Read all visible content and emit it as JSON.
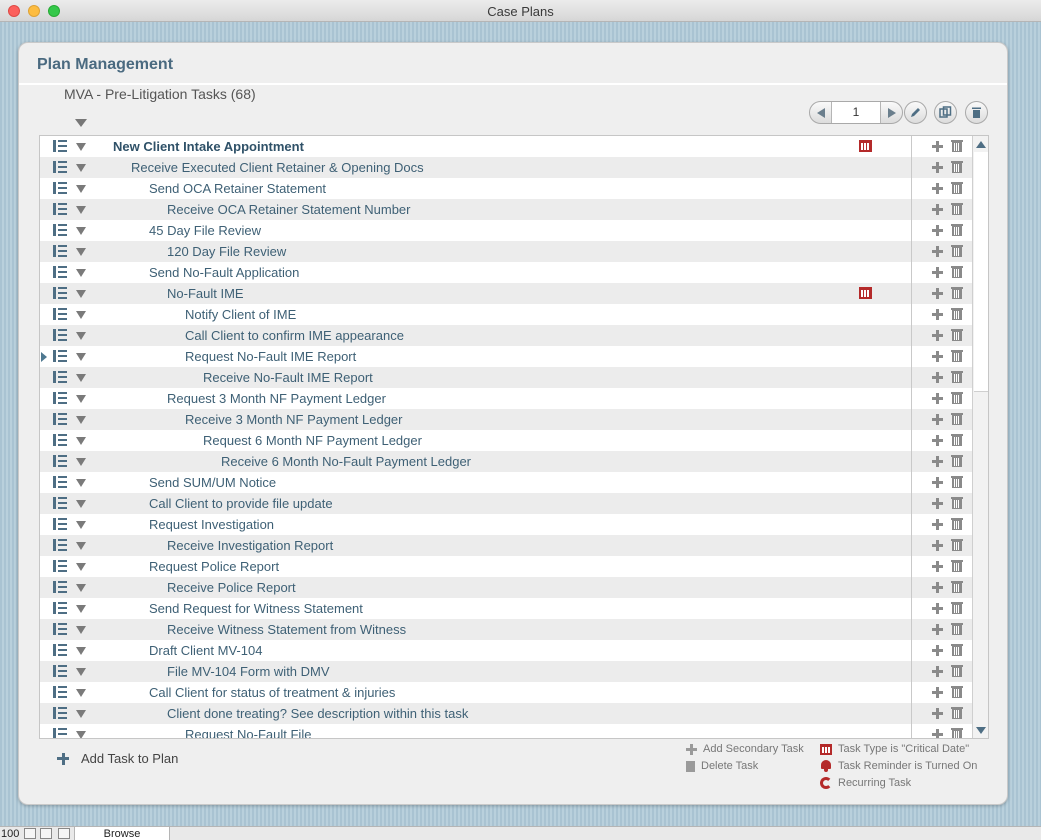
{
  "window": {
    "title": "Case Plans"
  },
  "panel": {
    "title": "Plan Management",
    "subtitle": "MVA - Pre-Litigation Tasks (68)"
  },
  "pager": {
    "page": "1"
  },
  "tasks": [
    {
      "label": "New Client Intake Appointment",
      "level": 0,
      "bold": true,
      "critical_date": true
    },
    {
      "label": "Receive Executed Client Retainer & Opening Docs",
      "level": 1
    },
    {
      "label": "Send OCA Retainer Statement",
      "level": 2
    },
    {
      "label": "Receive OCA Retainer Statement Number",
      "level": 3
    },
    {
      "label": "45 Day File Review",
      "level": 2
    },
    {
      "label": "120 Day File Review",
      "level": 3
    },
    {
      "label": "Send No-Fault Application",
      "level": 2
    },
    {
      "label": "No-Fault IME",
      "level": 3,
      "critical_date": true
    },
    {
      "label": "Notify Client of IME",
      "level": 4
    },
    {
      "label": "Call Client to confirm IME appearance",
      "level": 4
    },
    {
      "label": "Request No-Fault IME Report",
      "level": 4,
      "selected": true
    },
    {
      "label": "Receive No-Fault IME Report",
      "level": 5
    },
    {
      "label": "Request 3 Month NF Payment Ledger",
      "level": 3
    },
    {
      "label": "Receive 3 Month NF Payment Ledger",
      "level": 4
    },
    {
      "label": "Request 6 Month NF Payment Ledger",
      "level": 5
    },
    {
      "label": "Receive 6 Month No-Fault Payment Ledger",
      "level": 6
    },
    {
      "label": "Send SUM/UM Notice",
      "level": 2
    },
    {
      "label": "Call Client to provide file update",
      "level": 2
    },
    {
      "label": "Request Investigation",
      "level": 2
    },
    {
      "label": "Receive Investigation Report",
      "level": 3
    },
    {
      "label": "Request Police Report",
      "level": 2
    },
    {
      "label": "Receive Police Report",
      "level": 3
    },
    {
      "label": "Send Request for Witness Statement",
      "level": 2
    },
    {
      "label": "Receive Witness Statement from Witness",
      "level": 3
    },
    {
      "label": "Draft Client MV-104",
      "level": 2
    },
    {
      "label": "File MV-104 Form with DMV",
      "level": 3
    },
    {
      "label": "Call Client for status of treatment & injuries",
      "level": 2
    },
    {
      "label": "Client done treating?  See description within this task",
      "level": 3
    },
    {
      "label": "Request No-Fault File",
      "level": 4
    }
  ],
  "footer": {
    "add_task": "Add Task to Plan",
    "legend": {
      "add_secondary": "Add Secondary Task",
      "delete_task": "Delete Task",
      "critical_date": "Task Type is \"Critical Date\"",
      "reminder": "Task Reminder is Turned On",
      "recurring": "Recurring Task"
    }
  },
  "statusbar": {
    "zoom": "100",
    "mode": "Browse"
  },
  "colors": {
    "accent": "#4e6e84",
    "critical": "#b42a2a",
    "title": "#4a6a80"
  }
}
